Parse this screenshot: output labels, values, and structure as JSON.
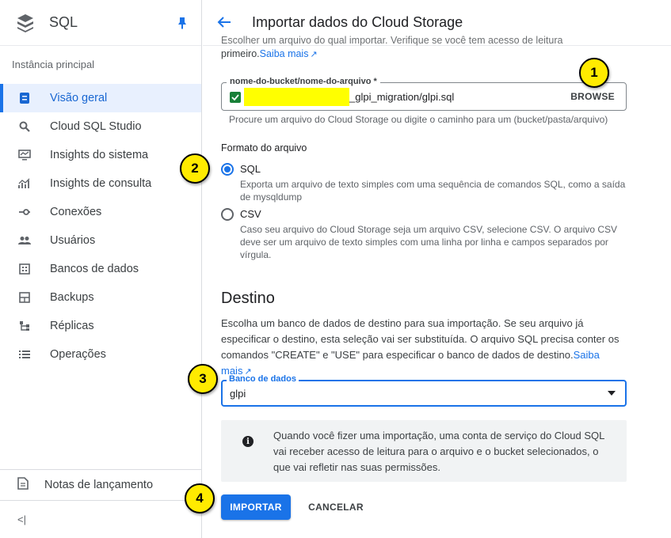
{
  "sidebar": {
    "title": "SQL",
    "section": "Instância principal",
    "items": [
      {
        "label": "Visão geral",
        "icon": "overview-icon"
      },
      {
        "label": "Cloud SQL Studio",
        "icon": "search-icon"
      },
      {
        "label": "Insights do sistema",
        "icon": "monitor-icon"
      },
      {
        "label": "Insights de consulta",
        "icon": "chart-icon"
      },
      {
        "label": "Conexões",
        "icon": "connections-icon"
      },
      {
        "label": "Usuários",
        "icon": "users-icon"
      },
      {
        "label": "Bancos de dados",
        "icon": "databases-icon"
      },
      {
        "label": "Backups",
        "icon": "backups-icon"
      },
      {
        "label": "Réplicas",
        "icon": "replicas-icon"
      },
      {
        "label": "Operações",
        "icon": "list-icon"
      }
    ],
    "release_notes": "Notas de lançamento",
    "collapse": "<|"
  },
  "header": {
    "title": "Importar dados do Cloud Storage"
  },
  "source": {
    "intro_cut": "Escolher um arquivo do qual importar. Verifique se você tem acesso de leitura",
    "intro_rest": "primeiro.",
    "learn_more": "Saiba mais",
    "field_label": "nome-do-bucket/nome-do-arquivo *",
    "field_value": "_glpi_migration/glpi.sql",
    "browse": "BROWSE",
    "hint": "Procure um arquivo do Cloud Storage ou digite o caminho para um (bucket/pasta/arquivo)"
  },
  "format": {
    "title": "Formato do arquivo",
    "options": [
      {
        "label": "SQL",
        "desc": "Exporta um arquivo de texto simples com uma sequência de comandos SQL, como a saída de mysqldump",
        "selected": true
      },
      {
        "label": "CSV",
        "desc": "Caso seu arquivo do Cloud Storage seja um arquivo CSV, selecione CSV. O arquivo CSV deve ser um arquivo de texto simples com uma linha por linha e campos separados por vírgula.",
        "selected": false
      }
    ]
  },
  "destination": {
    "title": "Destino",
    "desc": "Escolha um banco de dados de destino para sua importação. Se seu arquivo já especificar o destino, esta seleção vai ser substituída. O arquivo SQL precisa conter os comandos \"CREATE\" e \"USE\" para especificar o banco de dados de destino.",
    "learn_more": "Saiba mais",
    "db_label": "Banco de dados",
    "db_value": "glpi"
  },
  "info": {
    "text": "Quando você fizer uma importação, uma conta de serviço do Cloud SQL vai receber acesso de leitura para o arquivo e o bucket selecionados, o que vai refletir nas suas permissões."
  },
  "actions": {
    "import": "IMPORTAR",
    "cancel": "CANCELAR"
  },
  "markers": [
    "1",
    "2",
    "3",
    "4"
  ],
  "colors": {
    "accent": "#1a73e8",
    "marker": "#ffeb00",
    "redaction": "#ffff00"
  }
}
